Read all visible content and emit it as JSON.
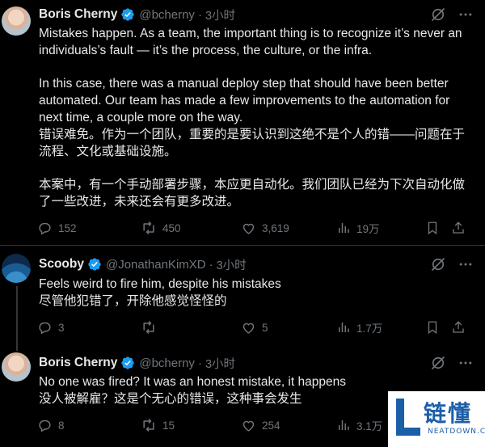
{
  "tweets": [
    {
      "name": "Boris Cherny",
      "handle": "@bcherny",
      "time": "3小时",
      "paragraphs": [
        "Mistakes happen. As a team, the important thing is to recognize it’s never an individuals’s fault — it’s the process, the culture, or the infra.",
        "In this case, there was a manual deploy step that should have been better automated. Our team has made a few improvements to the automation for next time, a couple more on the way.\n错误难免。作为一个团队，重要的是要认识到这绝不是个人的错——问题在于流程、文化或基础设施。",
        "本案中，有一个手动部署步骤，本应更自动化。我们团队已经为下次自动化做了一些改进，未来还会有更多改进。"
      ],
      "replies": "152",
      "retweets": "450",
      "likes": "3,619",
      "views": "19万"
    },
    {
      "name": "Scooby",
      "handle": "@JonathanKimXD",
      "time": "3小时",
      "paragraphs": [
        "Feels weird to fire him, despite his mistakes\n尽管他犯错了，开除他感觉怪怪的"
      ],
      "replies": "3",
      "retweets": "",
      "likes": "5",
      "views": "1.7万"
    },
    {
      "name": "Boris Cherny",
      "handle": "@bcherny",
      "time": "3小时",
      "paragraphs": [
        "No one was fired? It was an honest mistake, it happens\n没人被解雇？这是个无心的错误，这种事会发生"
      ],
      "replies": "8",
      "retweets": "15",
      "likes": "254",
      "views": "3.1万"
    }
  ],
  "watermark": {
    "text": "链懂",
    "subtext": "NEATDOWN.COM"
  },
  "colors": {
    "background": "#000000",
    "text": "#e7e9ea",
    "muted": "#71767b",
    "verified": "#1d9bf0",
    "divider": "#2f3336"
  }
}
